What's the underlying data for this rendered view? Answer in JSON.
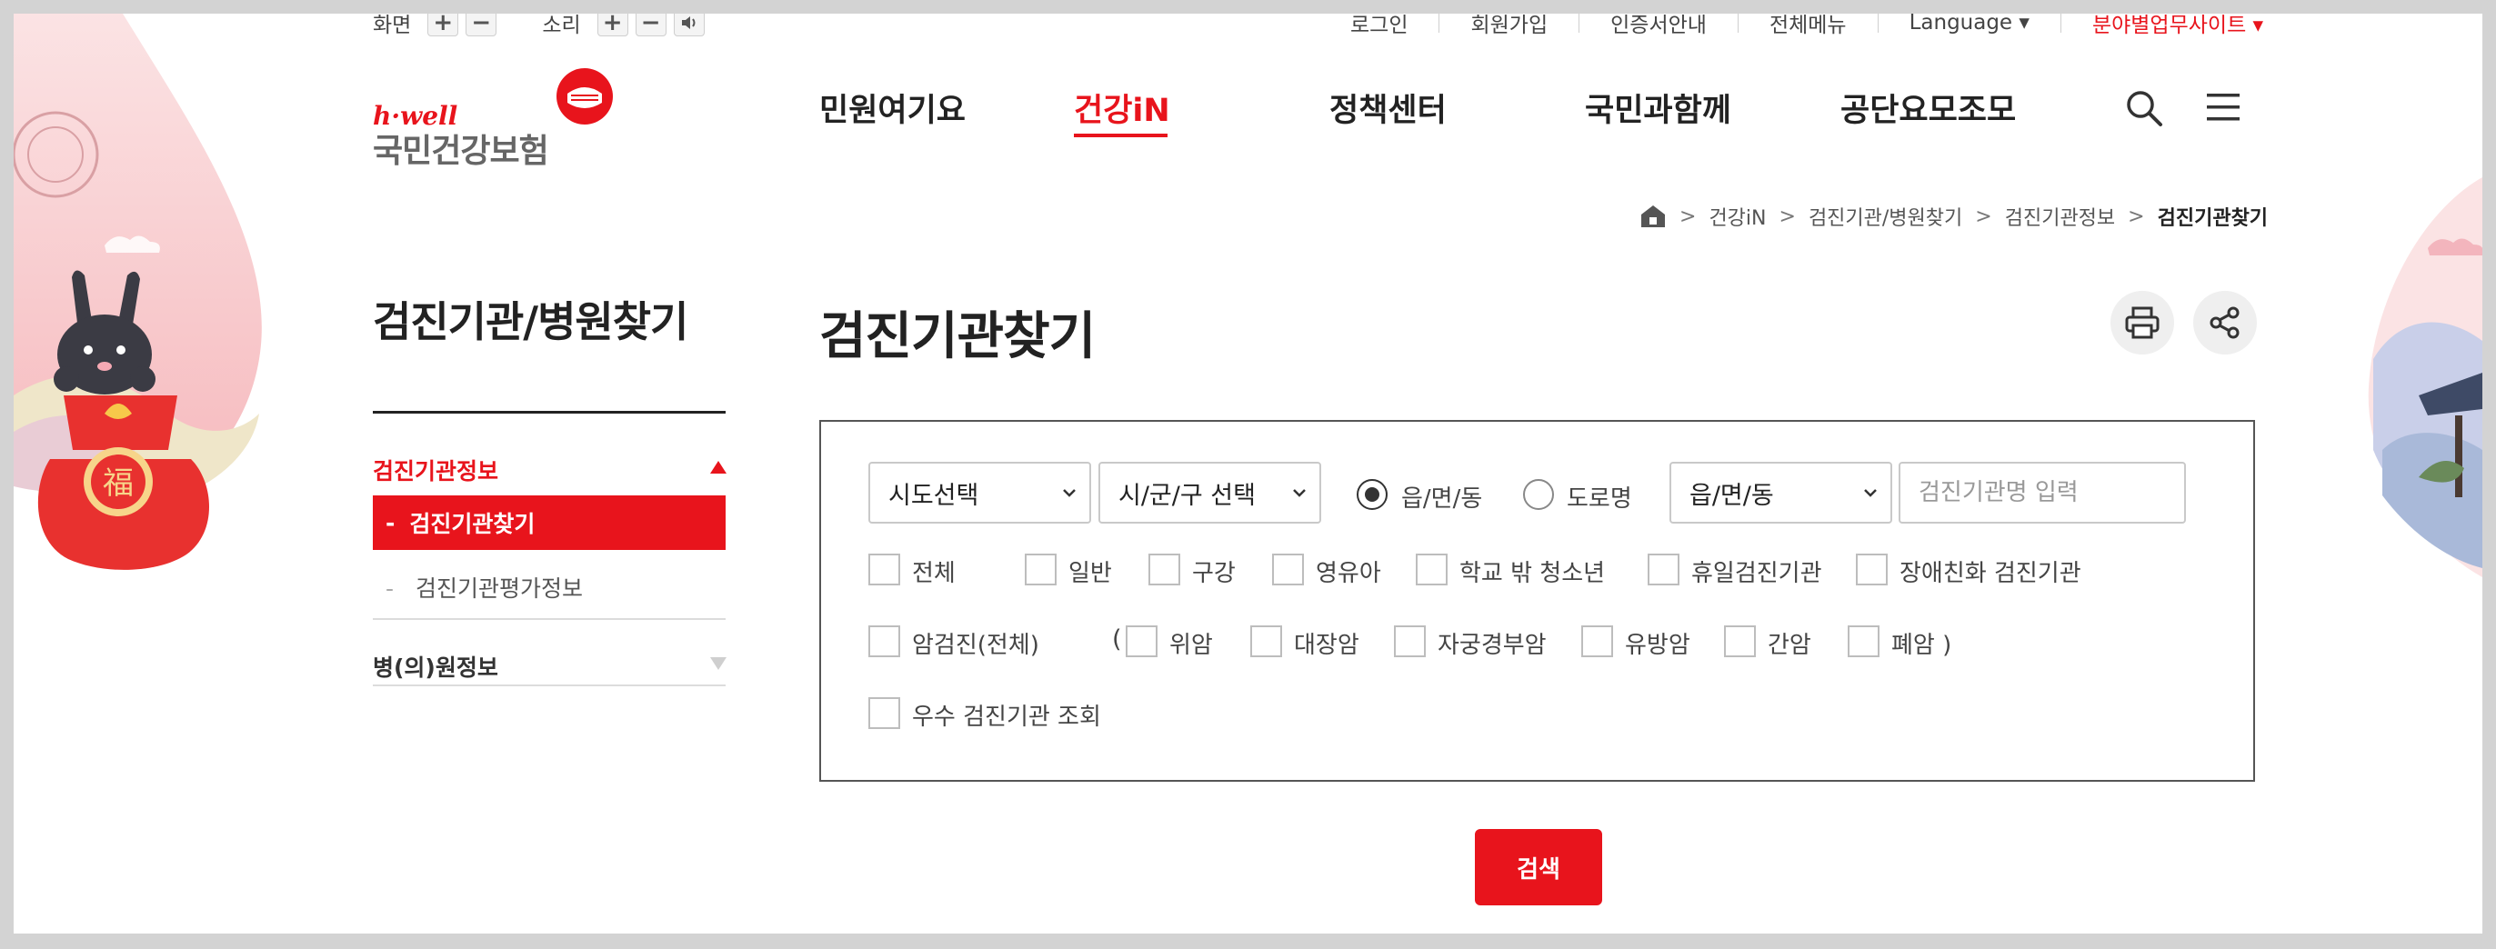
{
  "utility": {
    "screen_label": "화면",
    "sound_label": "소리",
    "plus": "+",
    "minus": "−",
    "sound_icon": "speaker-icon",
    "top_links": [
      {
        "label": "로그인"
      },
      {
        "label": "회원가입"
      },
      {
        "label": "인증서안내"
      },
      {
        "label": "전체메뉴"
      },
      {
        "label": "Language ▾"
      },
      {
        "label": "분야별업무사이트 ▾"
      }
    ]
  },
  "logo": {
    "tagline": "h·well",
    "name": "국민건강보험"
  },
  "gnb": [
    {
      "label": "민원여기요"
    },
    {
      "label": "건강iN"
    },
    {
      "label": "정책센터"
    },
    {
      "label": "국민과함께"
    },
    {
      "label": "공단요모조모"
    }
  ],
  "gnb_active": "건강iN",
  "icons": {
    "search": "search-icon",
    "menu": "hamburger-menu-icon",
    "home": "home-icon",
    "print": "printer-icon",
    "share": "share-icon"
  },
  "breadcrumb": [
    "건강iN",
    "검진기관/병원찾기",
    "검진기관정보",
    "검진기관찾기"
  ],
  "sidebar": {
    "title": "검진기관/병원찾기",
    "group1": "검진기관정보",
    "active_item": "검진기관찾기",
    "item2": "검진기관평가정보",
    "group2": "병(의)원정보",
    "active_marker": "-",
    "sub_marker": "-"
  },
  "main": {
    "title": "검진기관찾기"
  },
  "form": {
    "sido": "시도선택",
    "sigungu": "시/군/구 선택",
    "radio1": "읍/면/동",
    "radio2": "도로명",
    "emd": "읍/면/동",
    "name_placeholder": "검진기관명 입력",
    "row1": [
      "전체",
      "일반",
      "구강",
      "영유아",
      "학교 밖 청소년",
      "휴일검진기관",
      "장애친화 검진기관"
    ],
    "cancer_all": "암검진(전체)",
    "paren_open": "(",
    "row2": [
      "위암",
      "대장암",
      "자궁경부암",
      "유방암",
      "간암",
      "폐암 )"
    ],
    "excellent": "우수 검진기관 조회",
    "search_button": "검색"
  },
  "colors": {
    "brand_red": "#e8141c",
    "border": "#555555",
    "text": "#222222"
  }
}
